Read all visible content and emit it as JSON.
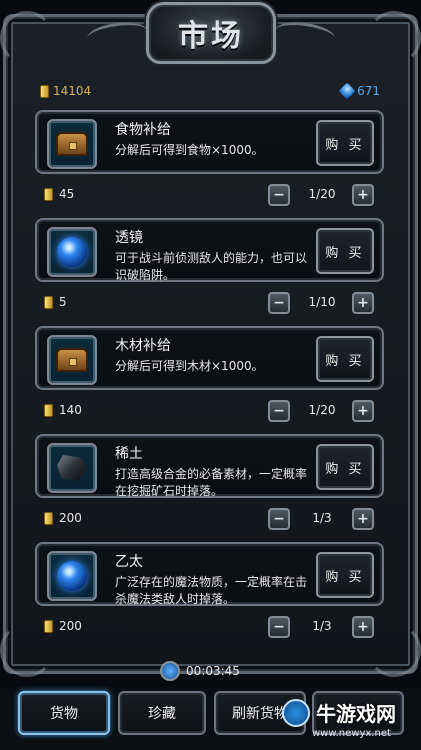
{
  "title": "市场",
  "currency": {
    "gold": "14104",
    "gems": "671"
  },
  "buy_label": "购 买",
  "items": [
    {
      "name": "食物补给",
      "desc": "分解后可得到食物×1000。",
      "icon": "chest-icon",
      "price": "45",
      "qty": "1/20"
    },
    {
      "name": "透镜",
      "desc": "可于战斗前侦测敌人的能力，也可以识破陷阱。",
      "icon": "blue-orb-icon",
      "price": "5",
      "qty": "1/10"
    },
    {
      "name": "木材补给",
      "desc": "分解后可得到木材×1000。",
      "icon": "chest-icon",
      "price": "140",
      "qty": "1/20"
    },
    {
      "name": "稀土",
      "desc": "打造高级合金的必备素材，一定概率在挖掘矿石时掉落。",
      "icon": "rock-icon",
      "price": "200",
      "qty": "1/3"
    },
    {
      "name": "乙太",
      "desc": "广泛存在的魔法物质，一定概率在击杀魔法类敌人时掉落。",
      "icon": "blue-orb-icon",
      "price": "200",
      "qty": "1/3"
    }
  ],
  "timer": "00:03:45",
  "nav": [
    {
      "label": "货物",
      "active": true
    },
    {
      "label": "珍藏",
      "active": false
    },
    {
      "label": "刷新货物",
      "active": false
    },
    {
      "label": "",
      "active": false
    }
  ],
  "watermark": {
    "text": "牛游戏网",
    "url": "www.newyx.net"
  }
}
